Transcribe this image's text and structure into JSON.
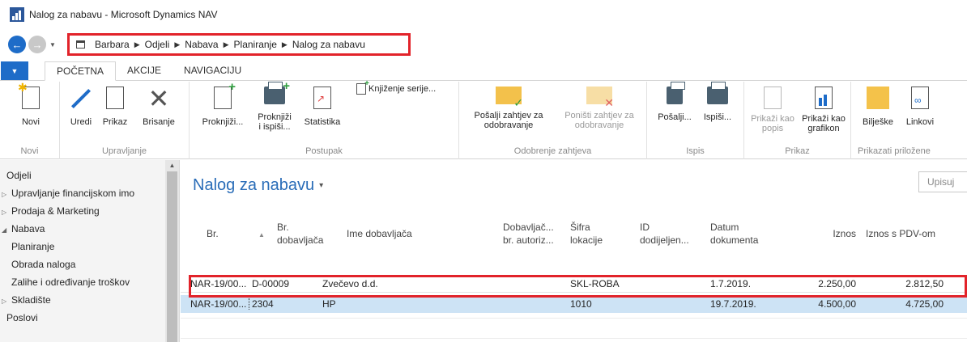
{
  "window": {
    "title": "Nalog za nabavu - Microsoft Dynamics NAV"
  },
  "breadcrumb": [
    "Barbara",
    "Odjeli",
    "Nabava",
    "Planiranje",
    "Nalog za nabavu"
  ],
  "ribbon_tabs": [
    "POČETNA",
    "AKCIJE",
    "NAVIGACIJU"
  ],
  "ribbon": {
    "groups": {
      "novi": "Novi",
      "upravljanje": "Upravljanje",
      "postupak": "Postupak",
      "odobrenje": "Odobrenje zahtjeva",
      "ispis": "Ispis",
      "prikaz": "Prikaz",
      "prilozene": "Prikazati priložene"
    },
    "buttons": {
      "novi": "Novi",
      "uredi": "Uredi",
      "prikaz": "Prikaz",
      "brisanje": "Brisanje",
      "proknjizi": "Proknjiži...",
      "proknjizi_ispisi_1": "Proknjiži",
      "proknjizi_ispisi_2": "i ispiši...",
      "statistika": "Statistika",
      "knjizenje_serije": "Knjiženje serije...",
      "posalji_zahtjev_1": "Pošalji zahtjev za",
      "posalji_zahtjev_2": "odobravanje",
      "ponisti_zahtjev_1": "Poništi zahtjev za",
      "ponisti_zahtjev_2": "odobravanje",
      "posalji": "Pošalji...",
      "ispisi": "Ispiši...",
      "prikazi_popis_1": "Prikaži kao",
      "prikazi_popis_2": "popis",
      "prikazi_grafikon_1": "Prikaži kao",
      "prikazi_grafikon_2": "grafikon",
      "biljeske": "Bilješke",
      "linkovi": "Linkovi"
    }
  },
  "nav": {
    "items": [
      {
        "label": "Odjeli",
        "arrow": ""
      },
      {
        "label": "Upravljanje financijskom imo",
        "arrow": "▷"
      },
      {
        "label": "Prodaja & Marketing",
        "arrow": "▷"
      },
      {
        "label": "Nabava",
        "arrow": "◢"
      },
      {
        "label": "Planiranje",
        "arrow": ""
      },
      {
        "label": "Obrada naloga",
        "arrow": ""
      },
      {
        "label": "Zalihe i određivanje troškov",
        "arrow": ""
      },
      {
        "label": "Skladište",
        "arrow": "▷"
      },
      {
        "label": "Poslovi",
        "arrow": ""
      }
    ]
  },
  "page": {
    "title": "Nalog za nabavu",
    "title_dropdown": "▾",
    "search_placeholder": "Upisuj"
  },
  "table": {
    "headers": {
      "br": "Br.",
      "br_dobavljaca_1": "Br.",
      "br_dobavljaca_2": "dobavljača",
      "ime_dobavljaca": "Ime dobavljača",
      "autoriz_1": "Dobavljač...",
      "autoriz_2": "br. autoriz...",
      "sifra_1": "Šifra",
      "sifra_2": "lokacije",
      "id_1": "ID",
      "id_2": "dodijeljen...",
      "datum_1": "Datum",
      "datum_2": "dokumenta",
      "iznos": "Iznos",
      "iznos_pdv": "Iznos s PDV-om"
    },
    "rows": [
      {
        "br": "NAR-19/00...",
        "br_dobavljaca": "D-00009",
        "ime": "Zvečevo d.d.",
        "autoriz": "",
        "sifra": "SKL-ROBA",
        "id": "",
        "datum": "1.7.2019.",
        "iznos": "2.250,00",
        "iznos_pdv": "2.812,50"
      },
      {
        "br": "NAR-19/00...",
        "br_dobavljaca": "2304",
        "ime": "HP",
        "autoriz": "",
        "sifra": "1010",
        "id": "",
        "datum": "19.7.2019.",
        "iznos": "4.500,00",
        "iznos_pdv": "4.725,00"
      }
    ]
  },
  "colors": {
    "accent": "#1e6cc8",
    "highlight": "#e2232a",
    "selected_row": "#cde3f5",
    "title": "#2a6db8"
  }
}
